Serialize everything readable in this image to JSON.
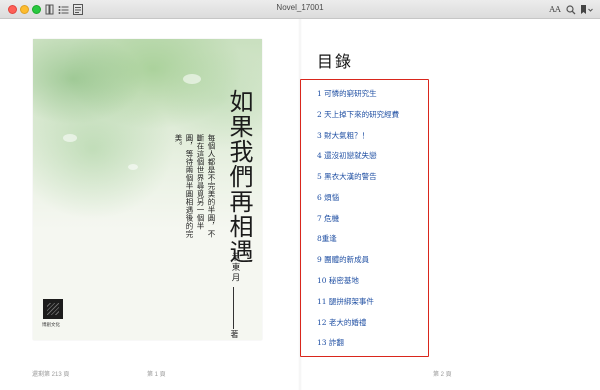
{
  "window": {
    "title": "Novel_17001"
  },
  "toolbar": {
    "left_icons": [
      "book-library-icon",
      "table-of-contents-icon",
      "notes-icon"
    ],
    "font_label": "AA",
    "right_icons": [
      "search-icon",
      "bookmark-icon"
    ]
  },
  "cover": {
    "title": "如果我們再相遇",
    "blurb": "每個人都是不完美的半圓，不斷在這個世界尋覓另一個半圓，等待兩個半圓相遇後的完美。",
    "author": "示東月",
    "author_suffix": "著",
    "publisher": "博創文化"
  },
  "toc": {
    "heading": "目錄",
    "items": [
      "1 可憐的窮研究生",
      "2 天上掉下來的研究經費",
      "3 財大氣粗？！",
      "4 還沒初戀就失戀",
      "5 黑衣大漢的警告",
      "6 煩惱",
      "7 危機",
      "8重逢",
      "9 團體的新成員",
      "10 秘密基地",
      "11 腿拚綁架事件",
      "12 老大的婚禮",
      "13 詐翻"
    ]
  },
  "footer": {
    "remaining": "還剩第 213 頁",
    "left_page": "第 1 頁",
    "right_page": "第 2 頁"
  }
}
